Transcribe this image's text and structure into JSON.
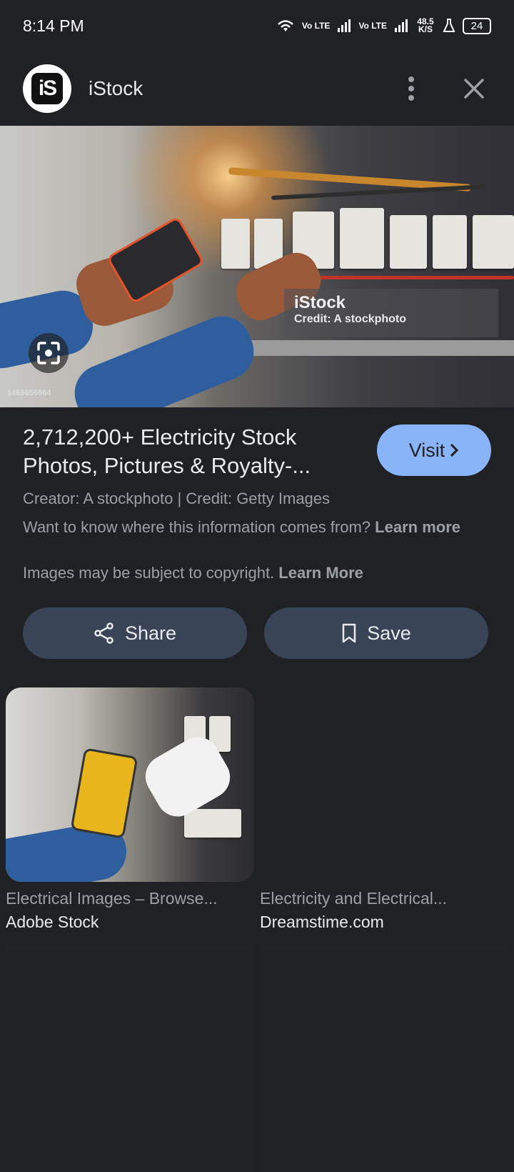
{
  "status_bar": {
    "time": "8:14 PM",
    "net1": "Vo LTE",
    "net2": "Vo LTE",
    "speed": "48.5 K/S",
    "battery": "24"
  },
  "header": {
    "site_logo_text": "iS",
    "site_name": "iStock"
  },
  "hero": {
    "watermark_brand": "iStock",
    "watermark_credit": "Credit: A stockphoto",
    "image_id": "1469656864"
  },
  "details": {
    "title": "2,712,200+ Electricity Stock Photos, Pictures & Royalty-...",
    "visit_label": "Visit",
    "creator_line": "Creator: A stockphoto | Credit: Getty Images",
    "info_prefix": "Want to know where this information comes from?",
    "info_link": "Learn more",
    "copyright_prefix": "Images may be subject to copyright.",
    "copyright_link": "Learn More"
  },
  "actions": {
    "share_label": "Share",
    "save_label": "Save"
  },
  "related": [
    {
      "title": "Electrical Images – Browse...",
      "source": "Adobe Stock"
    },
    {
      "title": "Electricity and Electrical...",
      "source": "Dreamstime.com"
    }
  ],
  "colors": {
    "background": "#202124",
    "accent": "#8ab4f8",
    "button": "#394457"
  }
}
